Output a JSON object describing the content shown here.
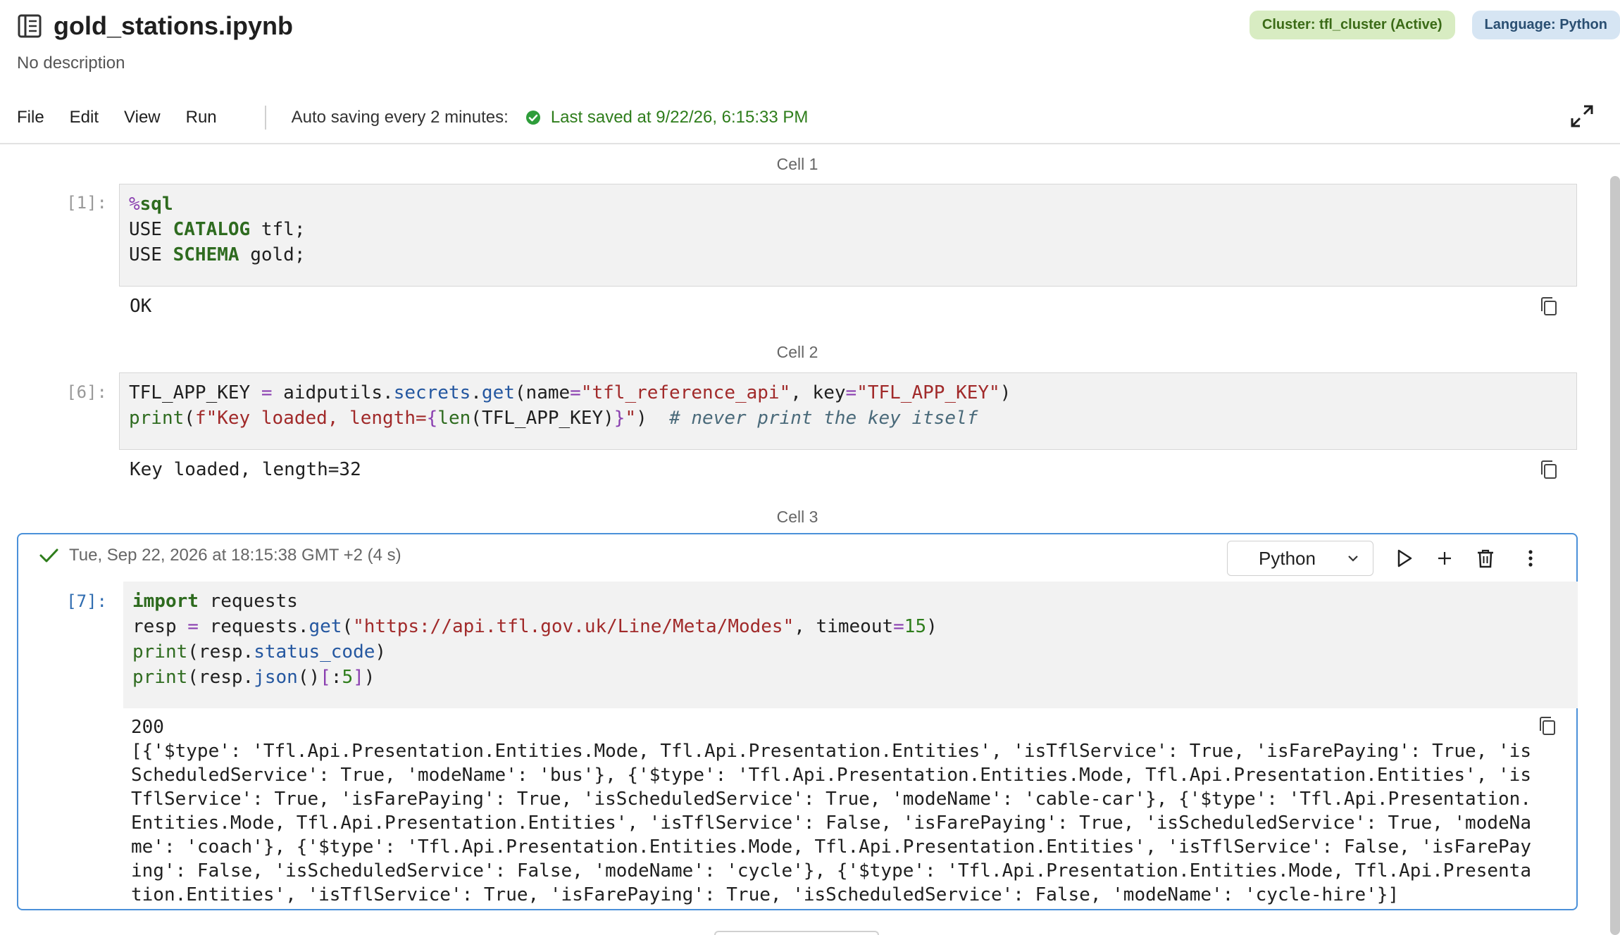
{
  "notebook": {
    "title": "gold_stations.ipynb",
    "description": "No description",
    "cluster_badge": "Cluster: tfl_cluster (Active)",
    "language_badge": "Language: Python"
  },
  "menu": {
    "file": "File",
    "edit": "Edit",
    "view": "View",
    "run": "Run",
    "autosave": "Auto saving every 2 minutes:",
    "last_saved": "Last saved at 9/22/26, 6:15:33 PM"
  },
  "cells": [
    {
      "label": "Cell 1",
      "prompt": "[1]:",
      "code_lines": [
        "%sql",
        "USE CATALOG tfl;",
        "USE SCHEMA gold;"
      ],
      "output": "OK"
    },
    {
      "label": "Cell 2",
      "prompt": "[6]:",
      "code_lines": [
        "TFL_APP_KEY = aidputils.secrets.get(name=\"tfl_reference_api\", key=\"TFL_APP_KEY\")",
        "print(f\"Key loaded, length={len(TFL_APP_KEY)}\")  # never print the key itself"
      ],
      "output": "Key loaded, length=32"
    },
    {
      "label": "Cell 3",
      "prompt": "[7]:",
      "exec_info": "Tue, Sep 22, 2026 at 18:15:38 GMT +2 (4 s)",
      "language": "Python",
      "code_lines": [
        "import requests",
        "resp = requests.get(\"https://api.tfl.gov.uk/Line/Meta/Modes\", timeout=15)",
        "print(resp.status_code)",
        "print(resp.json()[:5])"
      ],
      "output_lines": [
        "200",
        "[{'$type': 'Tfl.Api.Presentation.Entities.Mode, Tfl.Api.Presentation.Entities', 'isTflService': True, 'isFarePaying': True, 'is",
        "ScheduledService': True, 'modeName': 'bus'}, {'$type': 'Tfl.Api.Presentation.Entities.Mode, Tfl.Api.Presentation.Entities', 'is",
        "TflService': True, 'isFarePaying': True, 'isScheduledService': True, 'modeName': 'cable-car'}, {'$type': 'Tfl.Api.Presentation.",
        "Entities.Mode, Tfl.Api.Presentation.Entities', 'isTflService': False, 'isFarePaying': True, 'isScheduledService': True, 'modeNa",
        "me': 'coach'}, {'$type': 'Tfl.Api.Presentation.Entities.Mode, Tfl.Api.Presentation.Entities', 'isTflService': False, 'isFarePay",
        "ing': False, 'isScheduledService': False, 'modeName': 'cycle'}, {'$type': 'Tfl.Api.Presentation.Entities.Mode, Tfl.Api.Presenta",
        "tion.Entities', 'isTflService': True, 'isFarePaying': True, 'isScheduledService': False, 'modeName': 'cycle-hire'}]"
      ]
    }
  ],
  "icons": {
    "notebook": "notebook-icon",
    "saved": "check-circle-icon",
    "expand": "expand-icon",
    "copy": "copy-icon",
    "run": "play-icon",
    "add": "plus-icon",
    "delete": "trash-icon",
    "more": "kebab-icon",
    "dropdown": "chevron-down-icon",
    "success": "checkmark-icon"
  },
  "colors": {
    "accent": "#4a90d9",
    "success": "#2e7d1b",
    "cluster_badge_bg": "#d8ecc2",
    "language_badge_bg": "#d6e5f3"
  }
}
